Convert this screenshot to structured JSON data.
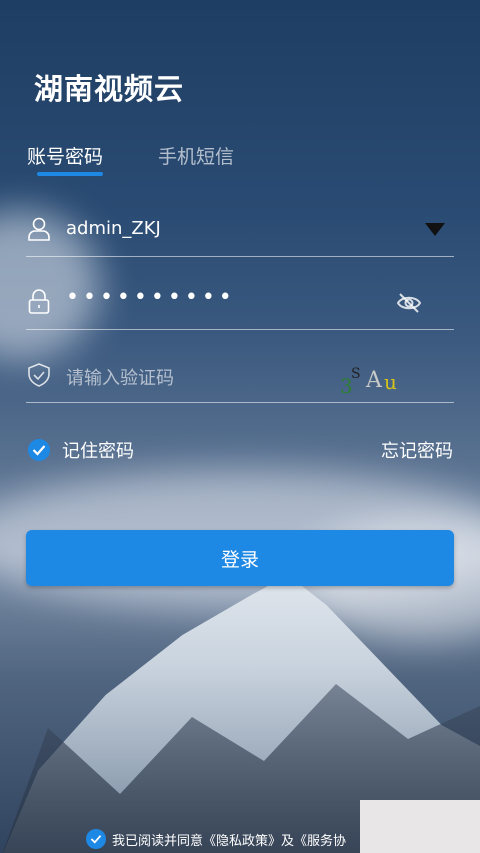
{
  "app": {
    "title": "湖南视频云"
  },
  "tabs": [
    {
      "label": "账号密码",
      "active": true
    },
    {
      "label": "手机短信",
      "active": false
    }
  ],
  "form": {
    "username": {
      "value": "admin_ZKJ",
      "icon": "user-icon"
    },
    "password": {
      "value": "••••••••••",
      "icon": "lock-icon",
      "toggle_icon": "eye-off-icon"
    },
    "captcha": {
      "placeholder": "请输入验证码",
      "icon": "shield-icon",
      "code": [
        "3",
        "S",
        "A",
        "u"
      ]
    }
  },
  "options": {
    "remember_label": "记住密码",
    "remember_checked": true,
    "forgot_label": "忘记密码"
  },
  "login_button": {
    "label": "登录"
  },
  "agreement": {
    "text": "我已阅读并同意",
    "privacy_link": "《隐私政策》",
    "and": "及",
    "service_link": "《服务协",
    "checked": true
  },
  "colors": {
    "accent": "#1e88e5",
    "text": "#ffffff"
  }
}
